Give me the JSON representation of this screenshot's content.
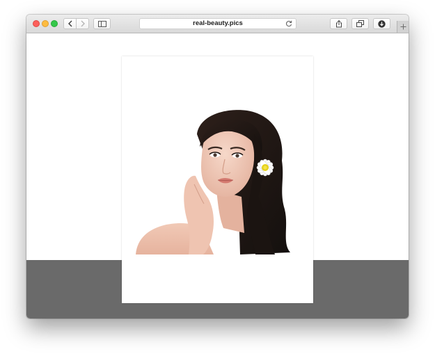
{
  "browser": {
    "address": "real-beauty.pics",
    "traffic_lights": {
      "close": "#fc605c",
      "minimize": "#fdbc40",
      "zoom": "#34c84a"
    },
    "toolbar_icons": [
      "chevron-left-icon",
      "chevron-right-icon",
      "sidebar-icon",
      "reload-icon",
      "share-icon",
      "tabs-icon",
      "download-icon",
      "plus-icon"
    ]
  },
  "page": {
    "footer_band_color": "#6a6a6a",
    "photo": {
      "subject": "woman-with-daisy-in-hair"
    }
  }
}
